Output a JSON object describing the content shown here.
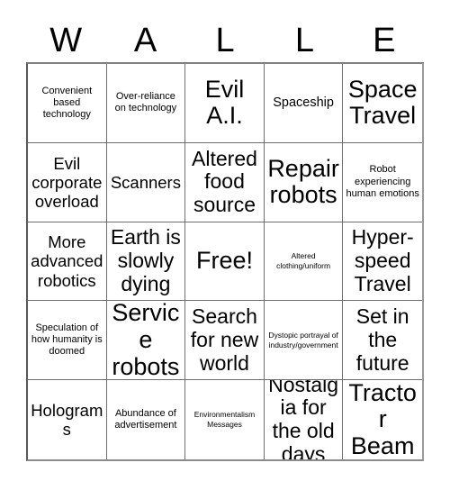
{
  "card": {
    "title_letters": [
      "W",
      "A",
      "L",
      "L",
      "E"
    ],
    "rows": 5,
    "columns": 5,
    "free_space_index": 12,
    "colors": {
      "background": "#ffffff",
      "text": "#000000",
      "grid_line": "#6e6e6e",
      "grid_border": "#808080"
    },
    "cells": [
      {
        "text": "Convenient based technology",
        "size": "sm"
      },
      {
        "text": "Over-reliance on technology",
        "size": "sm"
      },
      {
        "text": "Evil A.I.",
        "size": "xxl"
      },
      {
        "text": "Spaceship",
        "size": "md"
      },
      {
        "text": "Space Travel",
        "size": "xxl"
      },
      {
        "text": "Evil corporate overload",
        "size": "lg"
      },
      {
        "text": "Scanners",
        "size": "lg"
      },
      {
        "text": "Altered food source",
        "size": "xl"
      },
      {
        "text": "Repair robots",
        "size": "xxl"
      },
      {
        "text": "Robot experiencing human emotions",
        "size": "sm"
      },
      {
        "text": "More advanced robotics",
        "size": "lg"
      },
      {
        "text": "Earth is slowly dying",
        "size": "xl"
      },
      {
        "text": "Free!",
        "size": "xxl"
      },
      {
        "text": "Altered clothing/uniform",
        "size": "xs"
      },
      {
        "text": "Hyper-speed Travel",
        "size": "xl"
      },
      {
        "text": "Speculation of how humanity is doomed",
        "size": "sm"
      },
      {
        "text": "Service robots",
        "size": "xxl"
      },
      {
        "text": "Search for new world",
        "size": "xl"
      },
      {
        "text": "Dystopic portrayal of industry/government",
        "size": "xs"
      },
      {
        "text": "Set in the future",
        "size": "xl"
      },
      {
        "text": "Holograms",
        "size": "lg"
      },
      {
        "text": "Abundance of advertisement",
        "size": "sm"
      },
      {
        "text": "Environmentalism Messages",
        "size": "xs"
      },
      {
        "text": "Nostalgia for the old days",
        "size": "xl"
      },
      {
        "text": "Tractor Beam",
        "size": "xxl"
      }
    ]
  }
}
